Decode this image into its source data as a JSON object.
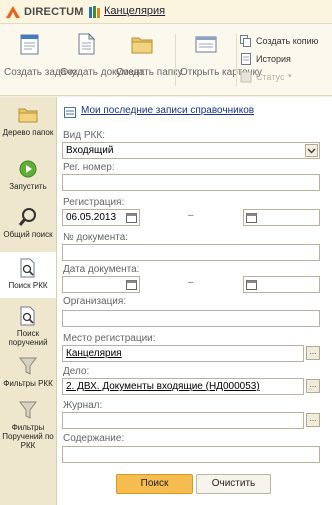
{
  "header": {
    "brand": "DIRECTUM",
    "app_title": "Канцелярия"
  },
  "toolbar": {
    "create_task": "Создать задачу",
    "create_document": "Создать документ",
    "create_folder": "Создать папку",
    "open_card": "Открыть карточку",
    "create_copy": "Создать копию",
    "history": "История",
    "status": "Статус"
  },
  "sidebar": {
    "items": [
      {
        "label": "Дерево папок"
      },
      {
        "label": "Запустить"
      },
      {
        "label": "Общий поиск"
      },
      {
        "label": "Поиск РКК"
      },
      {
        "label": "Поиск поручений"
      },
      {
        "label": "Фильтры РКК"
      },
      {
        "label": "Фильтры Поручений по РКК"
      }
    ]
  },
  "main": {
    "recent_link": "Мои последние записи справочников",
    "fields": {
      "vid_rkk_label": "Вид РКК:",
      "vid_rkk_value": "Входящий",
      "reg_nomer_label": "Рег. номер:",
      "reg_nomer_value": "",
      "registration_label": "Регистрация:",
      "registration_from": "06.05.2013",
      "registration_to": "",
      "doc_number_label": "№ документа:",
      "doc_number_value": "",
      "doc_date_label": "Дата документа:",
      "doc_date_from": "",
      "doc_date_to": "",
      "organization_label": "Организация:",
      "organization_value": "",
      "reg_place_label": "Место регистрации:",
      "reg_place_value": "Канцелярия",
      "delo_label": "Дело:",
      "delo_value": "2. ДВХ. Документы входящие (НД000053)",
      "journal_label": "Журнал:",
      "journal_value": "",
      "content_label": "Содержание:",
      "content_value": ""
    },
    "range_dash": "–",
    "dots": "...",
    "search_button": "Поиск",
    "clear_button": "Очистить"
  },
  "colors": {
    "accent": "#f5bd4f",
    "link": "#14348a",
    "sidebar_bg": "#efe7cd"
  }
}
